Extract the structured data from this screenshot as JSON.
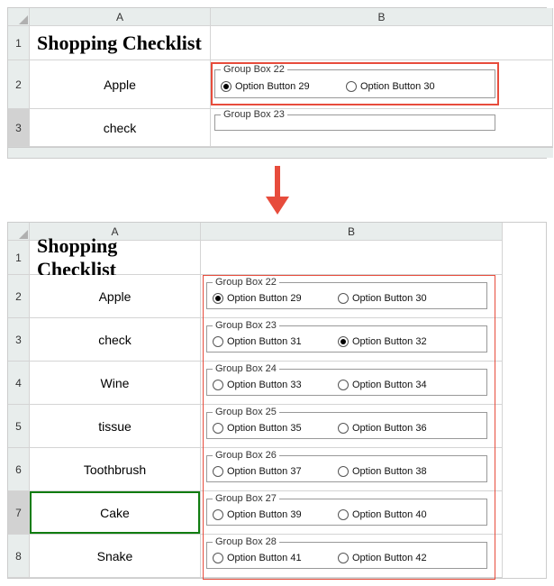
{
  "top": {
    "colA": "A",
    "colB": "B",
    "rows": [
      "1",
      "2",
      "3"
    ],
    "title": "Shopping Checklist",
    "items": [
      "Apple",
      "check"
    ],
    "groupBox22": {
      "legend": "Group Box 22",
      "opt1": {
        "label": "Option Button 29",
        "checked": true
      },
      "opt2": {
        "label": "Option Button 30",
        "checked": false
      }
    },
    "groupBox23Legend": "Group Box 23"
  },
  "bottom": {
    "colA": "A",
    "colB": "B",
    "rows": [
      "1",
      "2",
      "3",
      "4",
      "5",
      "6",
      "7",
      "8"
    ],
    "title": "Shopping Checklist",
    "items": [
      "Apple",
      "check",
      "Wine",
      "tissue",
      "Toothbrush",
      "Cake",
      "Snake"
    ],
    "groups": [
      {
        "legend": "Group Box 22",
        "opt1": {
          "label": "Option Button 29",
          "checked": true
        },
        "opt2": {
          "label": "Option Button 30",
          "checked": false
        }
      },
      {
        "legend": "Group Box 23",
        "opt1": {
          "label": "Option Button 31",
          "checked": false
        },
        "opt2": {
          "label": "Option Button 32",
          "checked": true
        }
      },
      {
        "legend": "Group Box 24",
        "opt1": {
          "label": "Option Button 33",
          "checked": false
        },
        "opt2": {
          "label": "Option Button 34",
          "checked": false
        }
      },
      {
        "legend": "Group Box 25",
        "opt1": {
          "label": "Option Button 35",
          "checked": false
        },
        "opt2": {
          "label": "Option Button 36",
          "checked": false
        }
      },
      {
        "legend": "Group Box 26",
        "opt1": {
          "label": "Option Button 37",
          "checked": false
        },
        "opt2": {
          "label": "Option Button 38",
          "checked": false
        }
      },
      {
        "legend": "Group Box 27",
        "opt1": {
          "label": "Option Button 39",
          "checked": false
        },
        "opt2": {
          "label": "Option Button 40",
          "checked": false
        }
      },
      {
        "legend": "Group Box 28",
        "opt1": {
          "label": "Option Button 41",
          "checked": false
        },
        "opt2": {
          "label": "Option Button 42",
          "checked": false
        }
      }
    ]
  }
}
